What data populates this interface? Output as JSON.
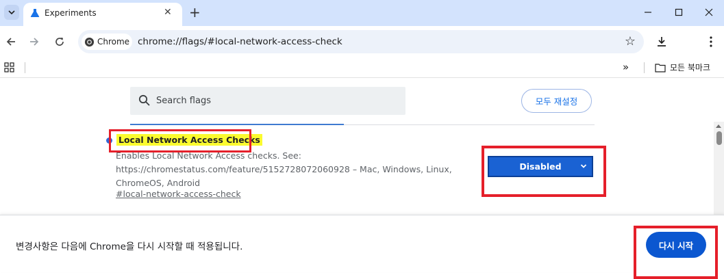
{
  "tab": {
    "title": "Experiments",
    "favicon": "flask-icon"
  },
  "toolbar": {
    "chip_label": "Chrome",
    "url": "chrome://flags/#local-network-access-check"
  },
  "bookmarks": {
    "all_bookmarks_label": "모든 북마크"
  },
  "flags_header": {
    "search_placeholder": "Search flags",
    "reset_all_label": "모두 재설정"
  },
  "flag": {
    "name": "Local Network Access Checks",
    "description": "Enables Local Network Access checks. See: https://chromestatus.com/feature/5152728072060928 – Mac, Windows, Linux, ChromeOS, Android",
    "link": "#local-network-access-check",
    "selected_option": "Disabled"
  },
  "footer": {
    "message": "변경사항은 다음에 Chrome을 다시 시작할 때 적용됩니다.",
    "restart_label": "다시 시작"
  },
  "colors": {
    "accent_blue": "#1a62d3",
    "highlight_yellow": "#fbfb2f",
    "annotation_red": "#e51f2a",
    "tabstrip_bg": "#d3e3fd"
  }
}
